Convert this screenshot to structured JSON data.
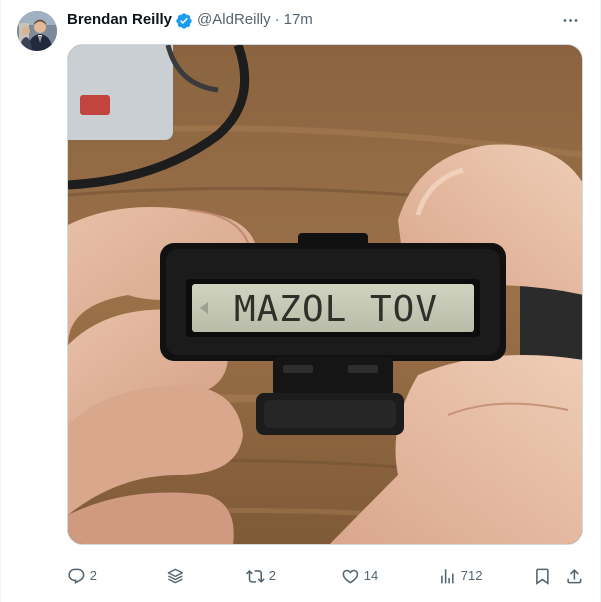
{
  "author": {
    "name": "Brendan Reilly",
    "handle": "@AldReilly",
    "separator": "·",
    "time": "17m",
    "verified": true,
    "verified_color": "#1d9bf0"
  },
  "media": {
    "lcd_text": "MAZOL TOV",
    "kind": "photo"
  },
  "actions": {
    "reply_count": "2",
    "repost_count": "2",
    "like_count": "14",
    "views_count": "712"
  },
  "icons": {
    "more": "more-icon",
    "reply": "reply-icon",
    "grok": "grok-icon",
    "repost": "repost-icon",
    "like": "heart-icon",
    "views": "views-icon",
    "bookmark": "bookmark-icon",
    "share": "share-icon"
  },
  "colors": {
    "text_primary": "#0f1419",
    "text_secondary": "#536471",
    "border": "#cfd9de"
  }
}
